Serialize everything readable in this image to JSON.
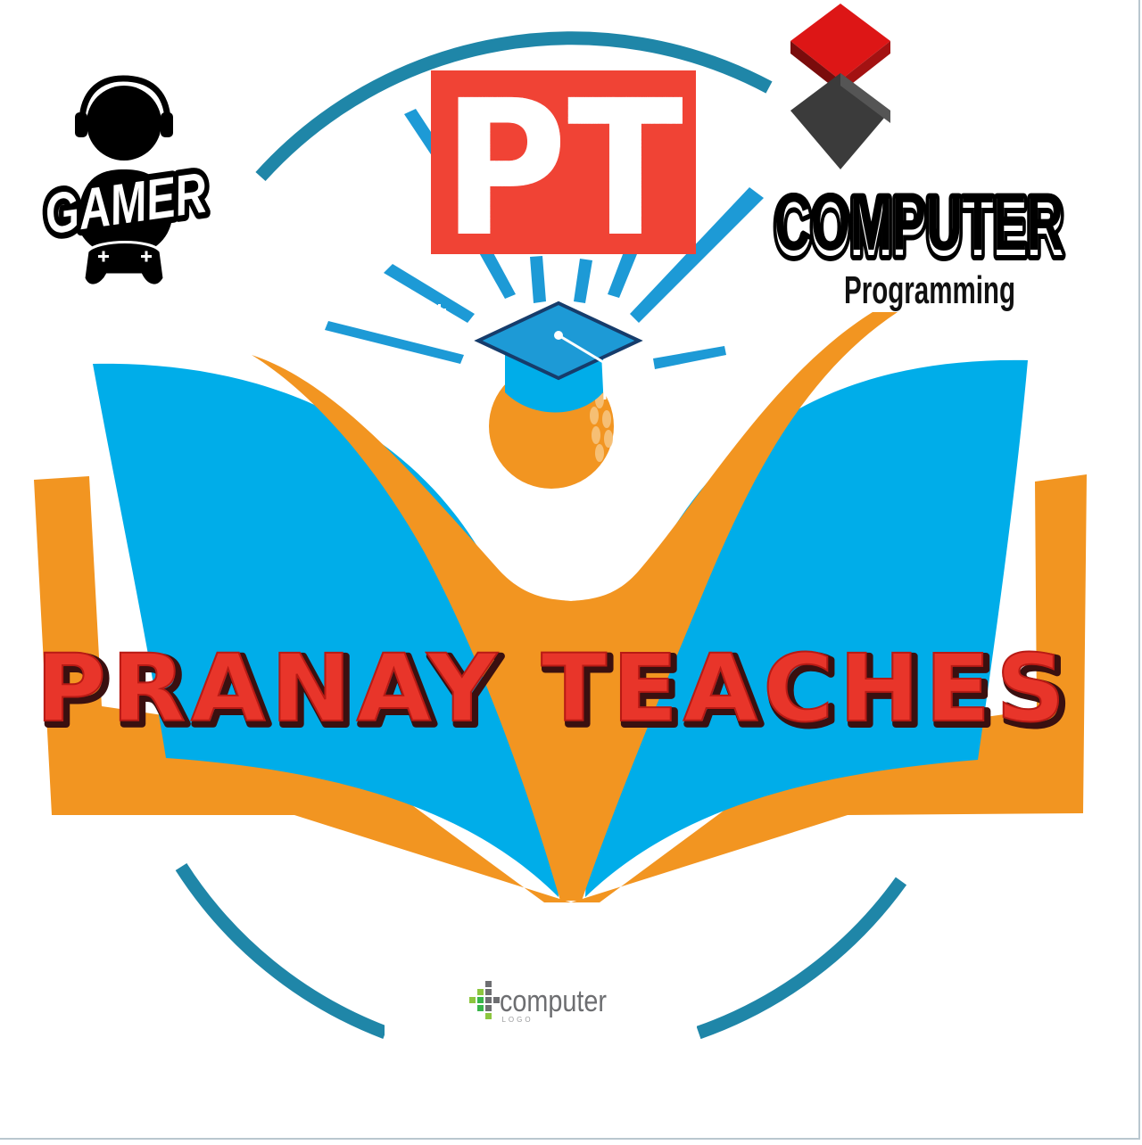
{
  "logo": {
    "title": "PRANAY TEACHES",
    "monogram": "PT",
    "gamer_badge": {
      "label": "GAMER"
    },
    "computer_badge": {
      "title": "COMPUTER",
      "subtitle": "Programming"
    },
    "small_logo": {
      "label": "computer",
      "sublabel": "LOGO"
    }
  },
  "colors": {
    "ring": "#1f86a8",
    "book_blue": "#00ade9",
    "book_orange": "#f29521",
    "pt_red": "#f04335",
    "title_red": "#e8352a",
    "cap_blue": "#1d9ad6",
    "cube_red": "#dd1616",
    "cube_dark": "#3b3b3b"
  }
}
